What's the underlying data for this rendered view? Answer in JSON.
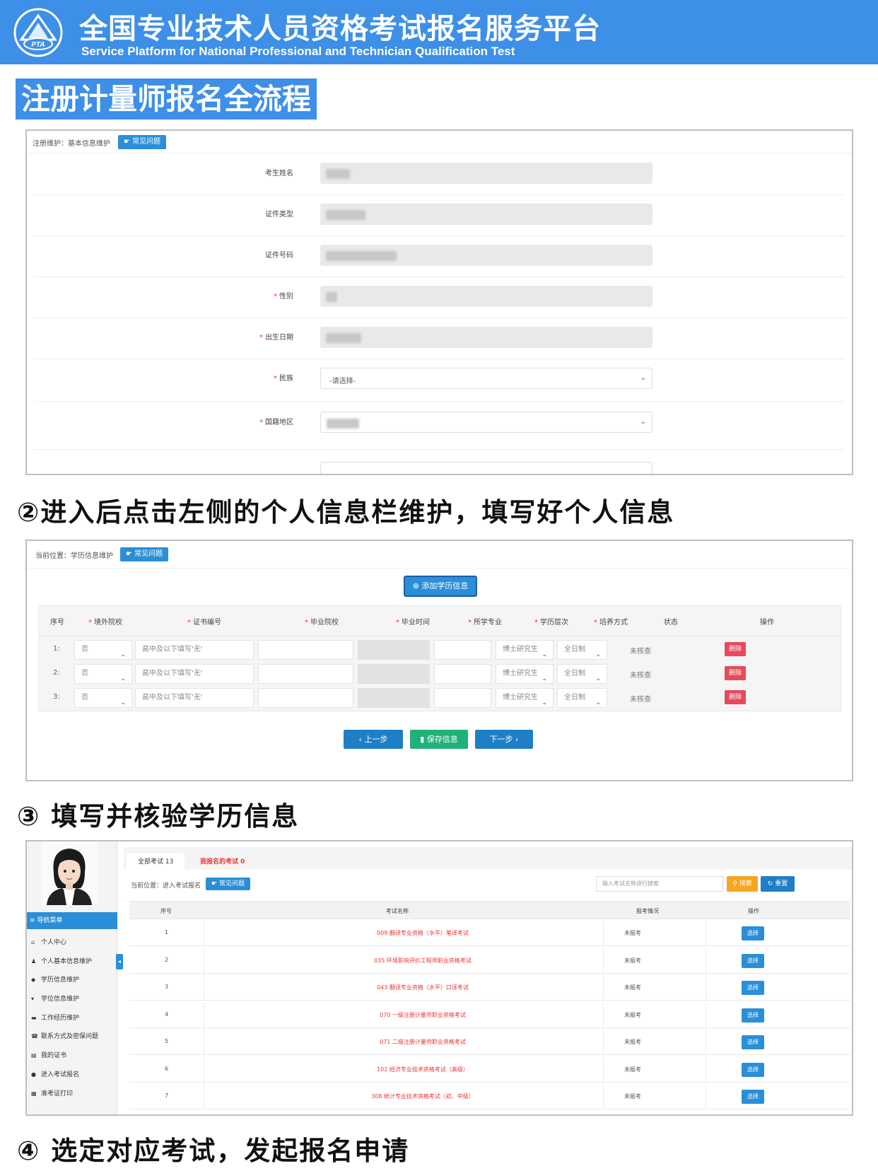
{
  "header": {
    "title_cn": "全国专业技术人员资格考试报名服务平台",
    "title_en": "Service Platform for National Professional and Technician Qualification Test",
    "logo_text": "PTA"
  },
  "main_title": "注册计量师报名全流程",
  "panel1": {
    "breadcrumb": "注册维护：基本信息维护",
    "faq_label": "常见问题",
    "fields": [
      {
        "label": "考生姓名",
        "required": false,
        "type": "blurred"
      },
      {
        "label": "证件类型",
        "required": false,
        "type": "blurred"
      },
      {
        "label": "证件号码",
        "required": false,
        "type": "blurred"
      },
      {
        "label": "性别",
        "required": true,
        "type": "blurred"
      },
      {
        "label": "出生日期",
        "required": true,
        "type": "blurred"
      },
      {
        "label": "民族",
        "required": true,
        "type": "select",
        "value": "-请选择-"
      },
      {
        "label": "国籍地区",
        "required": true,
        "type": "select-blurred"
      }
    ]
  },
  "caption2": "②进入后点击左侧的个人信息栏维护，填写好个人信息",
  "panel2": {
    "breadcrumb": "当前位置：学历信息维护",
    "faq_label": "常见问题",
    "add_label": "添加学历信息",
    "headers": [
      "序号",
      "境外院校",
      "证书编号",
      "毕业院校",
      "毕业时间",
      "所学专业",
      "学历层次",
      "培养方式",
      "状态",
      "操作"
    ],
    "rows": [
      {
        "no": "1:",
        "overseas": "否",
        "cert": "高中及以下填写'无'",
        "level": "博士研究生",
        "mode": "全日制",
        "status": "未核查",
        "op": "删除"
      },
      {
        "no": "2:",
        "overseas": "否",
        "cert": "高中及以下填写'无'",
        "level": "博士研究生",
        "mode": "全日制",
        "status": "未核查",
        "op": "删除"
      },
      {
        "no": "3:",
        "overseas": "否",
        "cert": "高中及以下填写'无'",
        "level": "博士研究生",
        "mode": "全日制",
        "status": "未核查",
        "op": "删除"
      }
    ],
    "prev_label": "上一步",
    "save_label": "保存信息",
    "next_label": "下一步"
  },
  "caption3": "③ 填写并核验学历信息",
  "panel3": {
    "nav_head": "导航菜单",
    "nav_items": [
      {
        "icon": "home-icon",
        "glyph": "⌂",
        "label": "个人中心"
      },
      {
        "icon": "user-icon",
        "glyph": "♟",
        "label": "个人基本信息维护"
      },
      {
        "icon": "graduation-cap-icon",
        "glyph": "◆",
        "label": "学历信息维护"
      },
      {
        "icon": "degree-icon",
        "glyph": "▾",
        "label": "学位信息维护"
      },
      {
        "icon": "briefcase-icon",
        "glyph": "▬",
        "label": "工作经历维护"
      },
      {
        "icon": "phone-icon",
        "glyph": "☎",
        "label": "联系方式及密保问题"
      },
      {
        "icon": "certificate-icon",
        "glyph": "▤",
        "label": "我的证书"
      },
      {
        "icon": "enter-exam-icon",
        "glyph": "●",
        "label": "进入考试报名"
      },
      {
        "icon": "ticket-icon",
        "glyph": "▦",
        "label": "准考证打印"
      }
    ],
    "tab_all": "全部考试 13",
    "tab_mine": "我报名的考试 0",
    "breadcrumb": "当前位置：进入考试报名",
    "faq_label": "常见问题",
    "search_placeholder": "输入考试名称进行搜索",
    "search_label": "搜索",
    "reset_label": "重置",
    "headers": [
      "序号",
      "考试名称",
      "报考情况",
      "操作"
    ],
    "rows": [
      {
        "no": "1",
        "name": "009 翻译专业资格（水平）笔译考试",
        "status": "未报考",
        "op": "选择"
      },
      {
        "no": "2",
        "name": "035 环境影响评价工程师职业资格考试",
        "status": "未报考",
        "op": "选择"
      },
      {
        "no": "3",
        "name": "043 翻译专业资格（水平）口译考试",
        "status": "未报考",
        "op": "选择"
      },
      {
        "no": "4",
        "name": "070 一级注册计量师职业资格考试",
        "status": "未报考",
        "op": "选择"
      },
      {
        "no": "5",
        "name": "071 二级注册计量师职业资格考试",
        "status": "未报考",
        "op": "选择"
      },
      {
        "no": "6",
        "name": "102 经济专业技术资格考试（高级）",
        "status": "未报考",
        "op": "选择"
      },
      {
        "no": "7",
        "name": "308 统计专业技术资格考试（初、中级）",
        "status": "未报考",
        "op": "选择"
      }
    ]
  },
  "caption4": "④ 选定对应考试，发起报名申请",
  "colors": {
    "brand_blue": "#3d8fe8",
    "button_blue": "#2a8fd8",
    "danger": "#e64a5a",
    "success": "#21b07a",
    "warning": "#f5a623"
  }
}
